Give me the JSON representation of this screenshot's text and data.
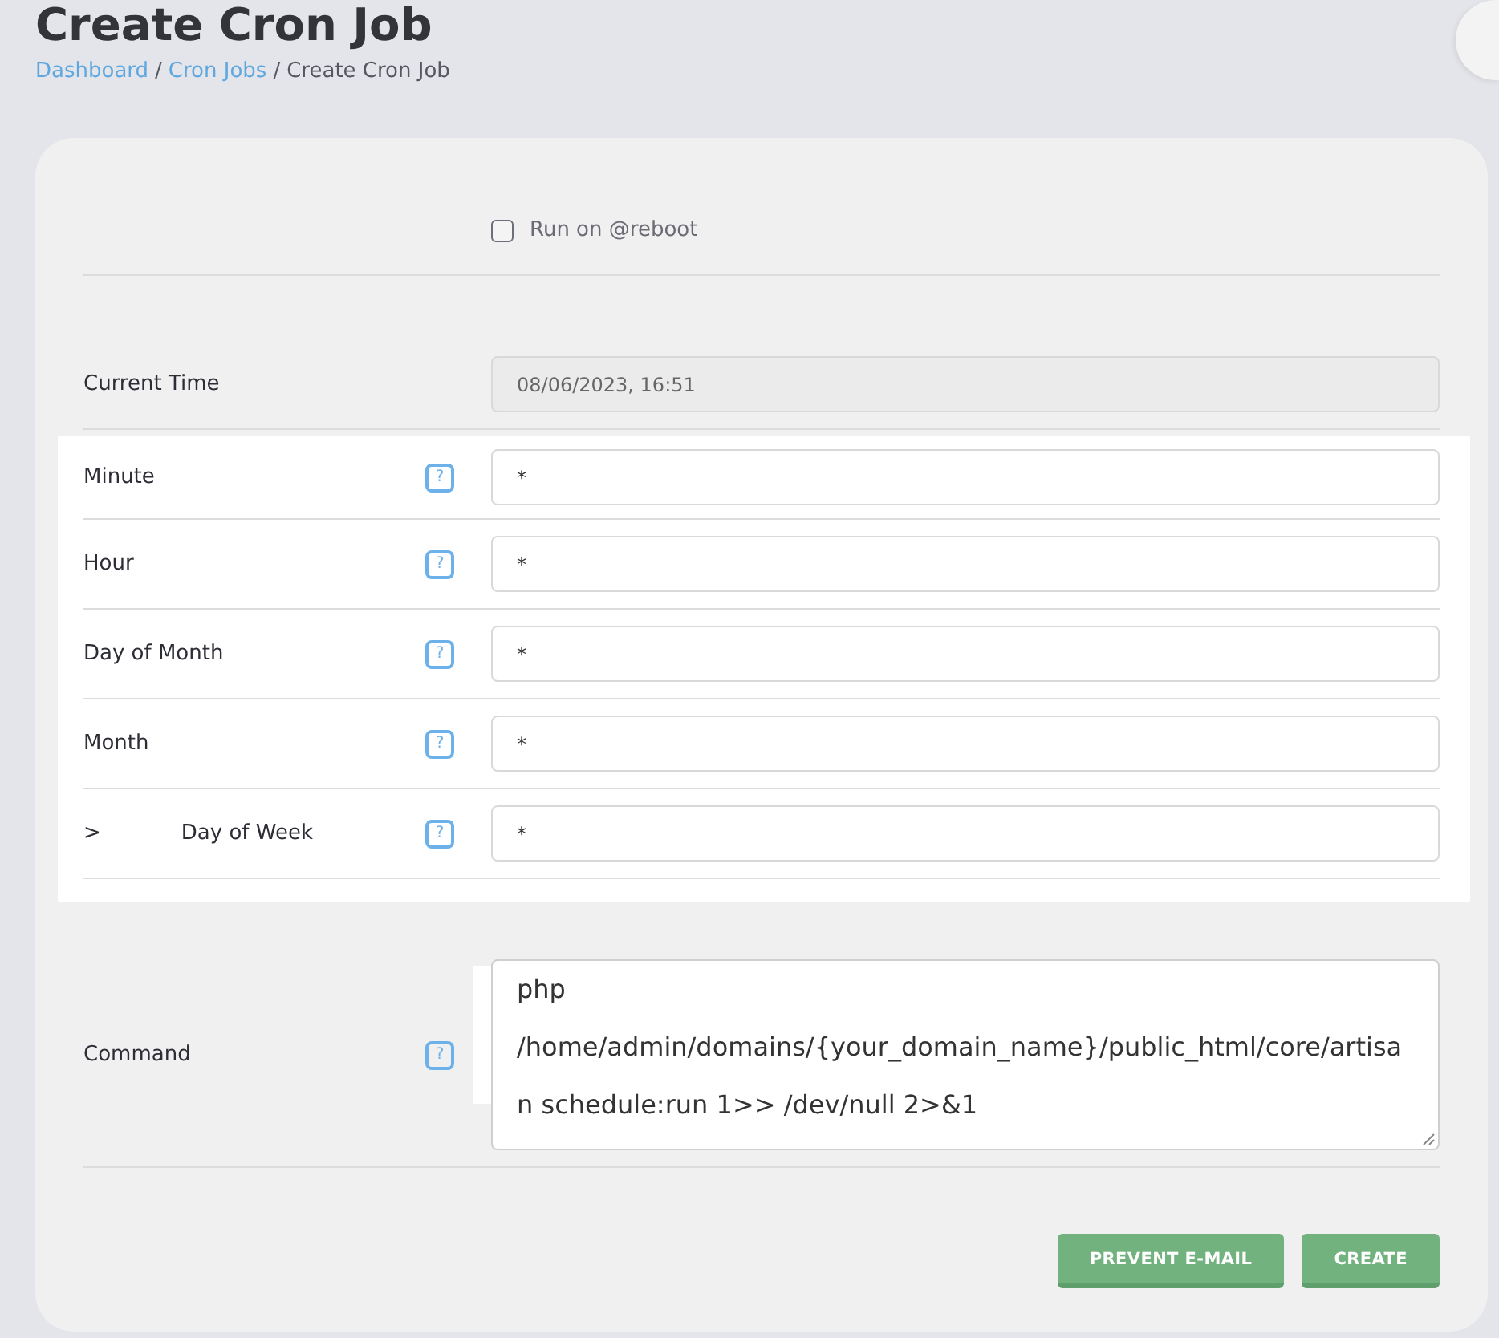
{
  "header": {
    "title": "Create Cron Job",
    "breadcrumb": [
      {
        "label": "Dashboard",
        "kind": "link"
      },
      {
        "label": "/",
        "kind": "separator"
      },
      {
        "label": "Cron Jobs",
        "kind": "link"
      },
      {
        "label": "/",
        "kind": "separator"
      },
      {
        "label": "Create Cron Job",
        "kind": "current"
      }
    ]
  },
  "form": {
    "reboot": {
      "label": "Run on @reboot",
      "checked": false
    },
    "current_time": {
      "label": "Current Time",
      "value": "08/06/2023, 16:51",
      "readonly": true
    },
    "schedule": {
      "highlighted": true,
      "fields": [
        {
          "label": "Minute",
          "help": "?",
          "value": "*"
        },
        {
          "label": "Hour",
          "help": "?",
          "value": "*"
        },
        {
          "label": "Day of Month",
          "help": "?",
          "value": "*"
        },
        {
          "label": "Month",
          "help": "?",
          "value": "*"
        },
        {
          "prefix": ">",
          "label": "Day of Week",
          "help": "?",
          "value": "*"
        }
      ]
    },
    "command": {
      "label": "Command",
      "help": "?",
      "value": "php /home/admin/domains/{your_domain_name}/public_html/core/artisan schedule:run 1>> /dev/null 2>&1"
    },
    "buttons": [
      "PREVENT E-MAIL",
      "CREATE"
    ]
  }
}
